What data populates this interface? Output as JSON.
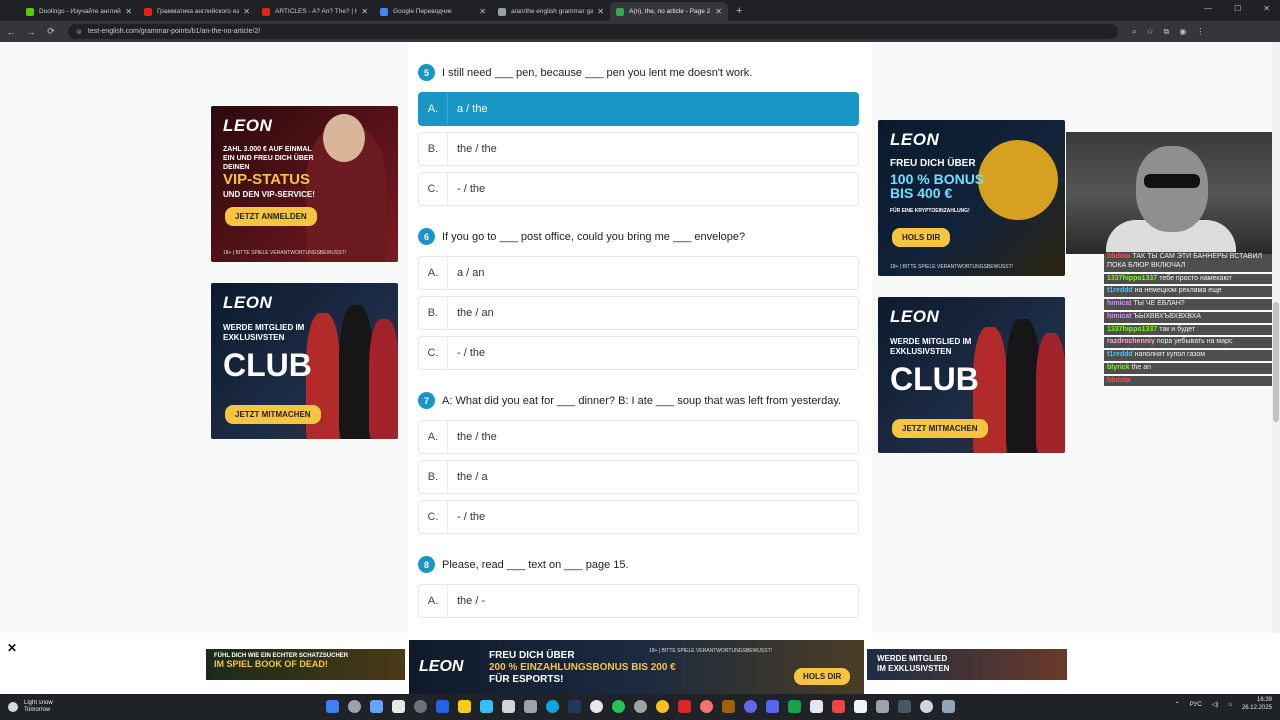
{
  "browser": {
    "tabs": [
      {
        "title": "Duolingo - Изучайте английск...",
        "color": "#58cc02",
        "active": false
      },
      {
        "title": "Грамматика английского язы...",
        "color": "#e62117",
        "active": false
      },
      {
        "title": "ARTICLES - A? An? The? | How ...",
        "color": "#e62117",
        "active": false
      },
      {
        "title": "Google Переводчик",
        "color": "#4285f4",
        "active": false
      },
      {
        "title": "a/an/the english grammar gam...",
        "color": "#9aa0a6",
        "active": false
      },
      {
        "title": "A(n), the, no article - Page 2 of...",
        "color": "#34a853",
        "active": true
      }
    ],
    "url": "test-english.com/grammar-points/b1/an-the-no-article/2/"
  },
  "quiz": {
    "questions": [
      {
        "number": "5",
        "text": "I still need ___ pen, because ___ pen you lent me doesn't work.",
        "options": [
          {
            "letter": "A.",
            "value": "a / the",
            "selected": true
          },
          {
            "letter": "B.",
            "value": "the / the",
            "selected": false
          },
          {
            "letter": "C.",
            "value": "- / the",
            "selected": false
          }
        ]
      },
      {
        "number": "6",
        "text": "If you go to ___ post office, could you bring me ___ envelope?",
        "options": [
          {
            "letter": "A.",
            "value": "a / an",
            "selected": false
          },
          {
            "letter": "B.",
            "value": "the / an",
            "selected": false
          },
          {
            "letter": "C.",
            "value": "- / the",
            "selected": false
          }
        ]
      },
      {
        "number": "7",
        "text": "A: What did you eat for ___ dinner? B: I ate ___ soup that was left from yesterday.",
        "options": [
          {
            "letter": "A.",
            "value": "the / the",
            "selected": false
          },
          {
            "letter": "B.",
            "value": "the / a",
            "selected": false
          },
          {
            "letter": "C.",
            "value": "- / the",
            "selected": false
          }
        ]
      },
      {
        "number": "8",
        "text": "Please, read ___ text on ___ page 15.",
        "options": [
          {
            "letter": "A.",
            "value": "the / -",
            "selected": false
          }
        ]
      }
    ]
  },
  "ads": {
    "vip": {
      "brand": "LEON",
      "line1": "ZAHL 3.000 € AUF EINMAL EIN UND FREU DICH ÜBER DEINEN",
      "big": "VIP-STATUS",
      "line2": "UND DEN VIP-SERVICE!",
      "cta": "JETZT ANMELDEN",
      "fine": "18+ | BITTE SPIELE VERANTWORTUNGSBEWUSST!"
    },
    "club_left": {
      "brand": "LEON",
      "line1": "WERDE MITGLIED IM EXKLUSIVSTEN",
      "big": "CLUB",
      "cta": "JETZT MITMACHEN"
    },
    "crypto": {
      "brand": "LEON",
      "line1": "FREU DICH ÜBER",
      "big": "100 % BONUS BIS 400 €",
      "line2": "FÜR EINE KRYPTOEINZAHLUNG!",
      "cta": "HOLS DIR",
      "fine": "18+ | BITTE SPIELE VERANTWORTUNGSBEWUSST!"
    },
    "club_right": {
      "brand": "LEON",
      "line1": "WERDE MITGLIED IM EXKLUSIVSTEN",
      "big": "CLUB",
      "cta": "JETZT MITMACHEN"
    },
    "bottom_left": {
      "line1": "FÜHL DICH WIE EIN ECHTER SCHATZSUCHER",
      "big": "IM SPIEL BOOK OF DEAD!"
    },
    "bottom_center": {
      "brand": "LEON",
      "line1": "FREU DICH ÜBER",
      "line2": "200 % EINZAHLUNGSBONUS BIS 200 €",
      "line3": "FÜR ESPORTS!",
      "fine": "18+ | BITTE SPIELE VERANTWORTUNGSBEWUSST!",
      "cta": "HOLS DIR"
    },
    "bottom_right": {
      "line1": "WERDE MITGLIED",
      "line2": "IM EXKLUSIVSTEN"
    }
  },
  "chat": [
    {
      "user": "bbdota",
      "color": "#ff4d4d",
      "text": "ТАК ТЫ САМ ЭТИ БАННЕРЫ ВСТАВИЛ ПОКА БЛЮР ВКЛЮЧАЛ"
    },
    {
      "user": "1337hippo1337",
      "color": "#7cfc00",
      "text": "тебе просто намекают"
    },
    {
      "user": "t1reddd",
      "color": "#4fc3ff",
      "text": "на немецком реклама еще"
    },
    {
      "user": "himicat",
      "color": "#d58cff",
      "text": "ТЫ ЧЕ ЕБЛАН?"
    },
    {
      "user": "himicat",
      "color": "#d58cff",
      "text": "ЪЫХВВХЪВХВХВХА"
    },
    {
      "user": "1337hippo1337",
      "color": "#7cfc00",
      "text": "так и будет"
    },
    {
      "user": "razdrochenniy",
      "color": "#ff9fd6",
      "text": "пора уебывать на марс"
    },
    {
      "user": "t1reddd",
      "color": "#4fc3ff",
      "text": "наполнят купол газом"
    },
    {
      "user": "blyrick",
      "color": "#7cfc00",
      "text": "the an"
    },
    {
      "user": "bbdota",
      "color": "#ff4d4d",
      "text": ""
    }
  ],
  "taskbar": {
    "weather_line1": "Light snow",
    "weather_line2": "Tomorrow",
    "lang": "РУС",
    "time": "16:39",
    "date": "26.12.2025"
  }
}
